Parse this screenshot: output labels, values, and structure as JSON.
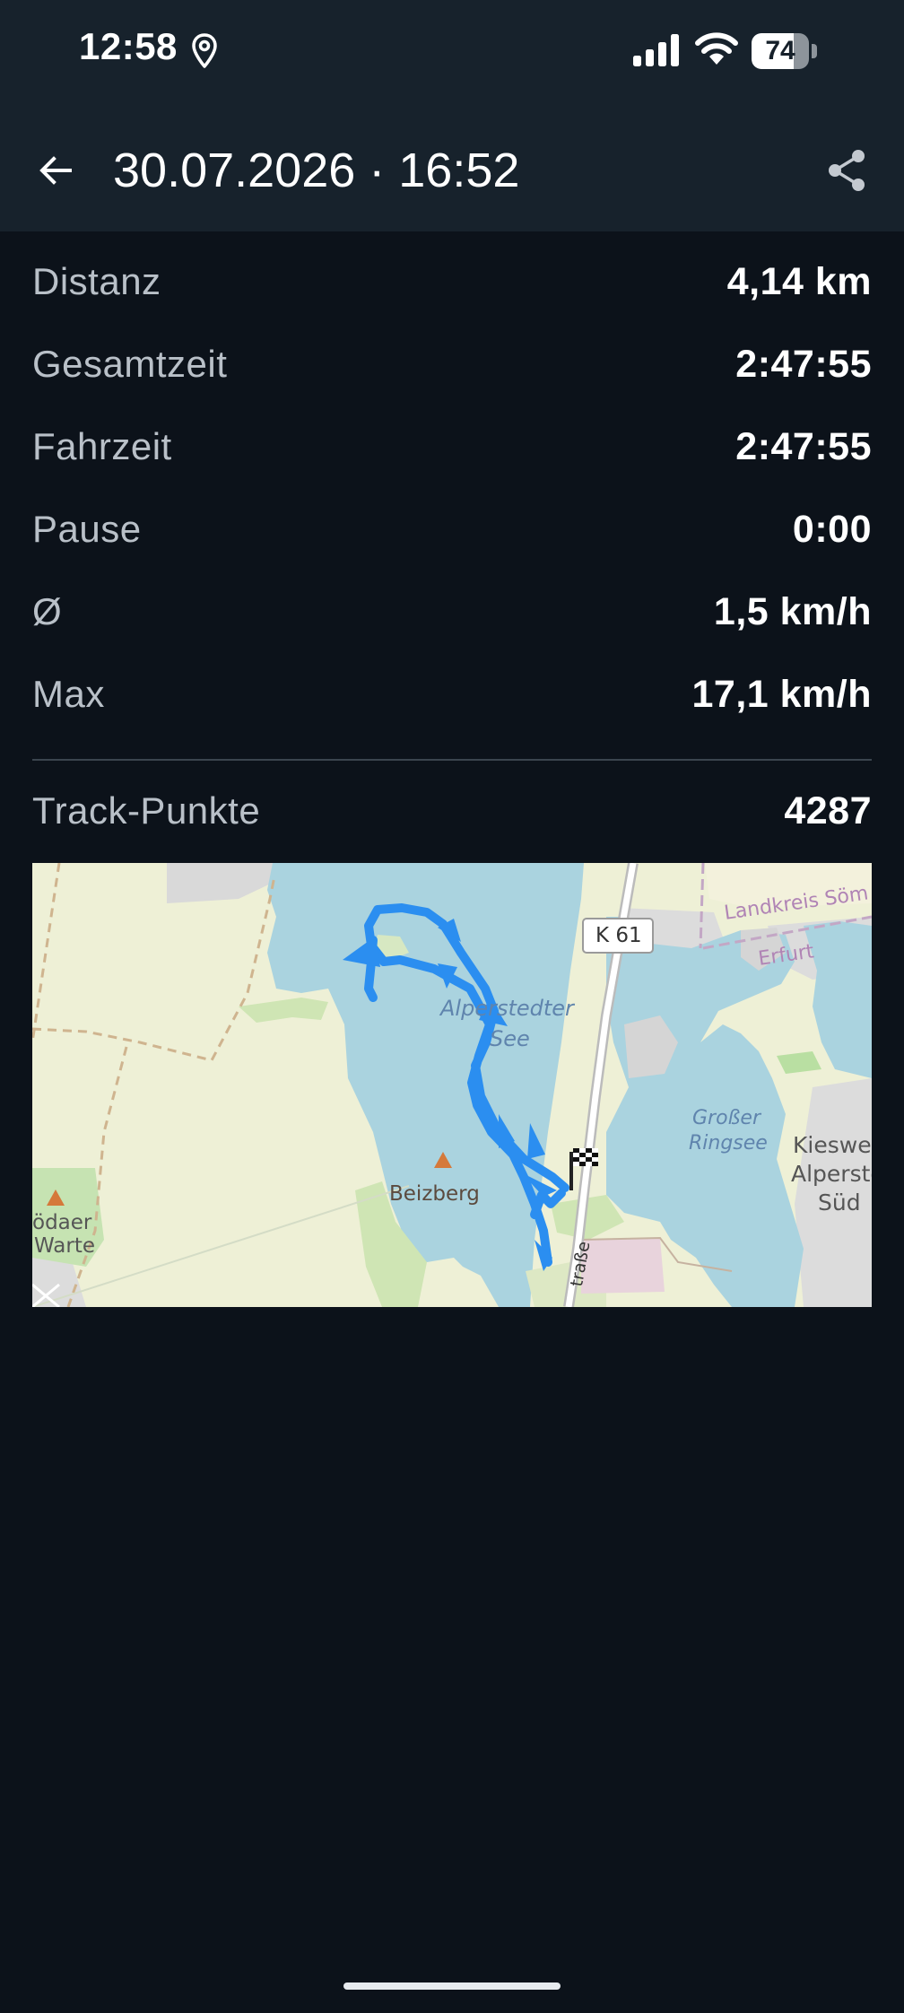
{
  "status_bar": {
    "time": "12:58",
    "battery_percent": 74,
    "battery_label": "74",
    "icons": [
      "location-pin-icon",
      "cellular-signal-icon",
      "wifi-icon",
      "battery-icon"
    ]
  },
  "app_bar": {
    "title": "30.07.2026 · 16:52",
    "back_icon": "arrow-left-icon",
    "share_icon": "share-icon"
  },
  "stats": [
    {
      "label": "Distanz",
      "value": "4,14 km"
    },
    {
      "label": "Gesamtzeit",
      "value": "2:47:55"
    },
    {
      "label": "Fahrzeit",
      "value": "2:47:55"
    },
    {
      "label": "Pause",
      "value": "0:00"
    },
    {
      "label": "Ø",
      "value": "1,5 km/h"
    },
    {
      "label": "Max",
      "value": "17,1 km/h"
    }
  ],
  "track_points": {
    "label": "Track-Punkte",
    "value": "4287"
  },
  "map": {
    "labels": {
      "road": "K 61",
      "district_1": "Landkreis Söm",
      "district_2": "Erfurt",
      "lake_1_line_1": "Alperstedter",
      "lake_1_line_2": "See",
      "lake_2_line_1": "Großer",
      "lake_2_line_2": "Ringsee",
      "area_1": "Kieswe",
      "area_2": "Alperste",
      "area_3": "Süd",
      "hill": "Beizberg",
      "place_1": "ödaer",
      "place_2": "Warte",
      "street": "traße"
    },
    "colors": {
      "water": "#aad3df",
      "land": "#eef0d6",
      "track": "#2b8ef0"
    },
    "finish_icon": "checkered-flag-icon"
  }
}
